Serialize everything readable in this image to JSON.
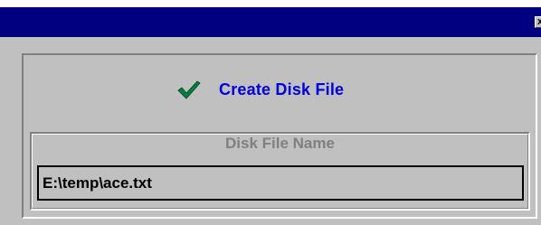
{
  "window": {
    "close_glyph": "x",
    "title_bar_color": "#000080"
  },
  "header": {
    "create_label": "Create Disk File",
    "check_icon": "checkmark-icon",
    "check_color": "#007f3f"
  },
  "group": {
    "title": "Disk File Name"
  },
  "disk_file_field": {
    "value": "E:\\temp\\ace.txt"
  }
}
